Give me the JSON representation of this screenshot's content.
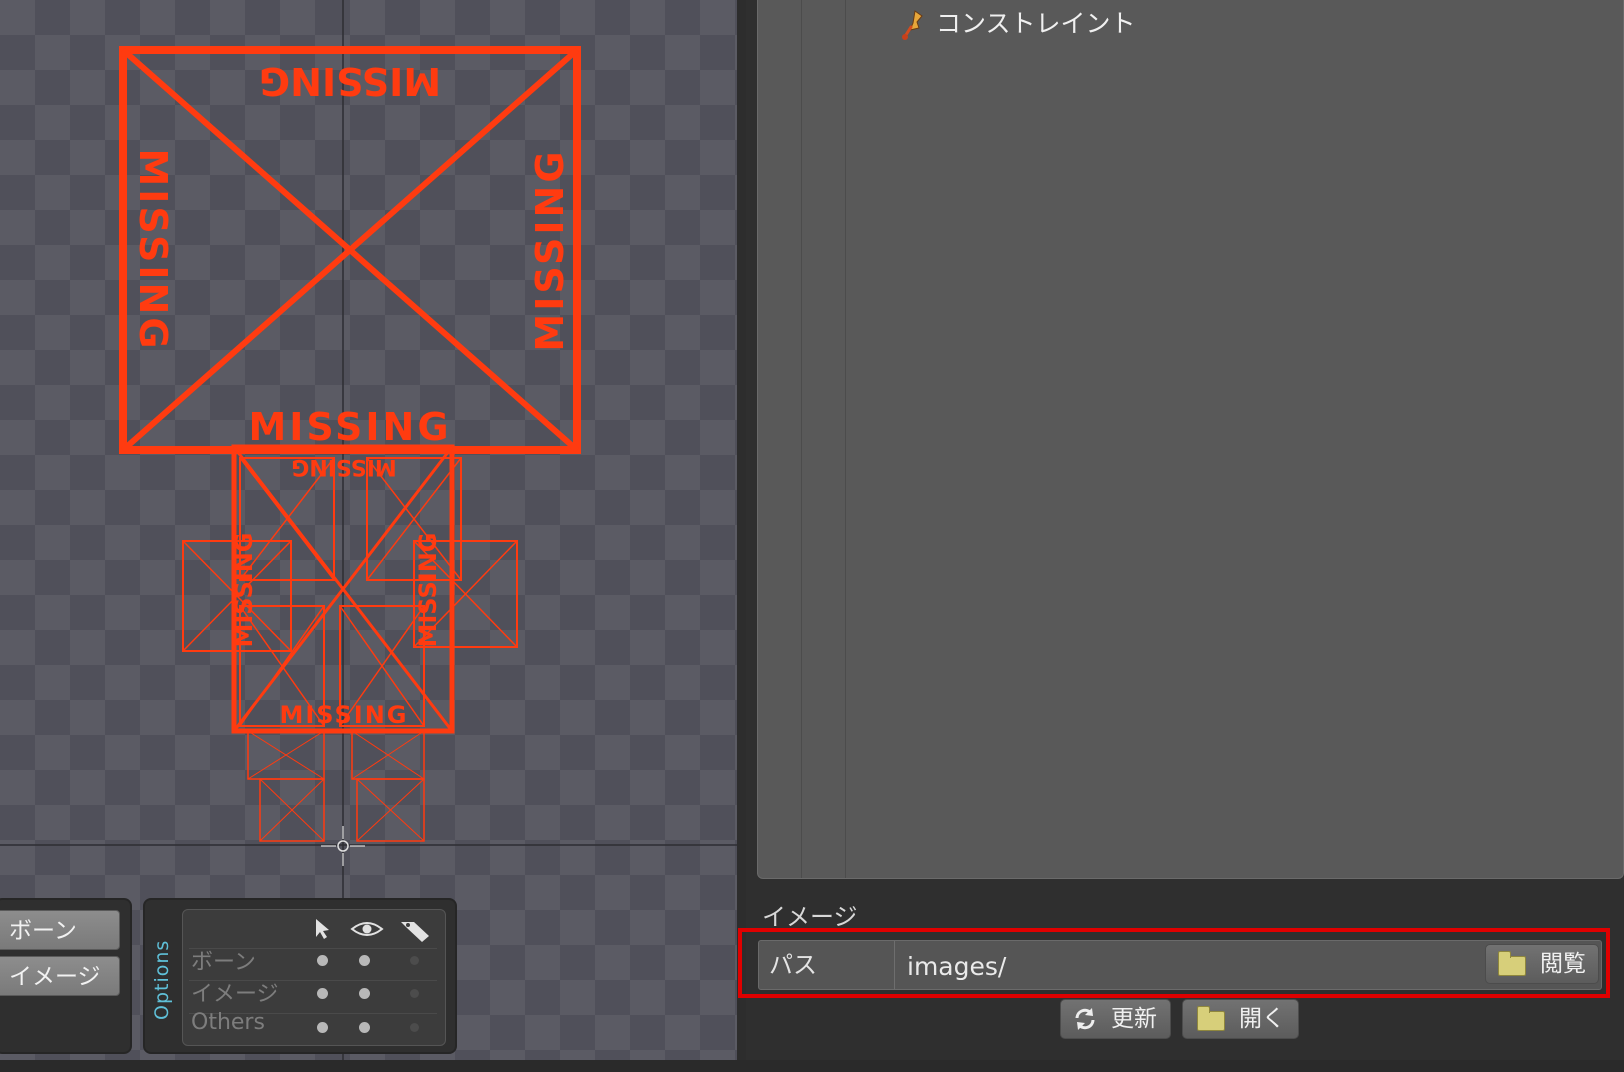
{
  "viewport": {
    "missing_text": "MISSING",
    "colors": {
      "missing": "#ff3b10",
      "checker_dark": "#50505a",
      "checker_light": "#5b5b64"
    }
  },
  "mode_buttons": {
    "bones": "ボーン",
    "images": "イメージ"
  },
  "options": {
    "title": "Options",
    "columns": [
      "select-cursor-icon",
      "visibility-eye-icon",
      "tag-icon"
    ],
    "rows": [
      {
        "label": "ボーン"
      },
      {
        "label": "イメージ"
      },
      {
        "label": "Others"
      }
    ]
  },
  "tree": {
    "constraint_label": "コンストレイント",
    "constraint_icon": "pin-constraint-icon"
  },
  "image_section": {
    "title": "イメージ",
    "path_label": "パス",
    "path_value": "images/",
    "browse_label": "閲覧",
    "refresh_label": "更新",
    "open_label": "開く"
  },
  "colors": {
    "highlight_frame": "#e00000",
    "accent_text": "#5fc0d8"
  }
}
